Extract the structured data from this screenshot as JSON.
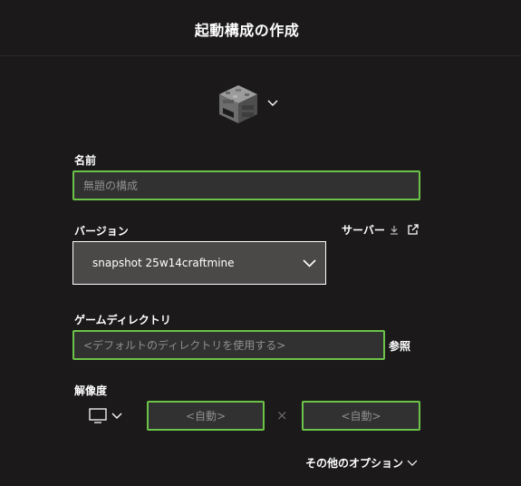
{
  "header": {
    "title": "起動構成の作成"
  },
  "icon_picker": {
    "icon": "furnace-block-icon",
    "chevron": "chevron-down-icon"
  },
  "name": {
    "label": "名前",
    "placeholder": "無題の構成",
    "value": ""
  },
  "version": {
    "label": "バージョン",
    "selected": "snapshot 25w14craftmine"
  },
  "server": {
    "label": "サーバー",
    "icons": [
      "download-icon",
      "external-link-icon"
    ]
  },
  "game_directory": {
    "label": "ゲームディレクトリ",
    "placeholder": "<デフォルトのディレクトリを使用する>",
    "browse_label": "参照"
  },
  "resolution": {
    "label": "解像度",
    "width_placeholder": "<自動>",
    "height_placeholder": "<自動>",
    "separator": "×",
    "display_icon": "monitor-icon"
  },
  "more_options": {
    "label": "その他のオプション"
  },
  "colors": {
    "background": "#1b1919",
    "accent_border": "#6cc349",
    "field_bg": "#313131",
    "select_bg": "#4b4848"
  }
}
